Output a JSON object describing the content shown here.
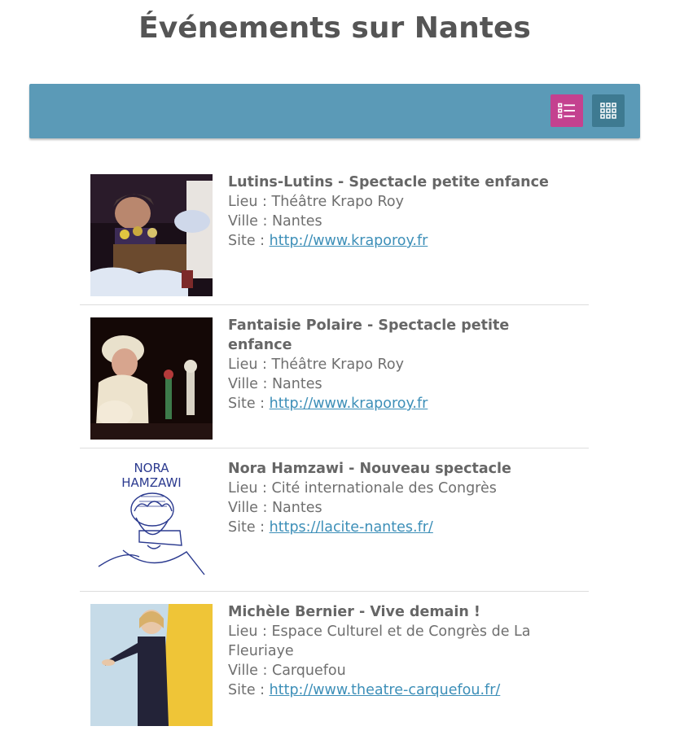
{
  "page": {
    "title": "Événements sur Nantes"
  },
  "toolbar": {
    "list_view_icon": "list-view-icon",
    "grid_view_icon": "grid-view-icon",
    "colors": {
      "bar": "#5b9ab7",
      "list_active": "#c4418f",
      "grid": "#3e7a91"
    }
  },
  "events": [
    {
      "title": "Lutins-Lutins - Spectacle petite enfance",
      "lieu_label": "Lieu : ",
      "lieu": "Théâtre Krapo Roy",
      "ville_label": "Ville : ",
      "ville": "Nantes",
      "site_label": "Site : ",
      "site": "http://www.kraporoy.fr",
      "image": "puppet-show-photo"
    },
    {
      "title": "Fantaisie Polaire - Spectacle petite enfance",
      "lieu_label": "Lieu : ",
      "lieu": "Théâtre Krapo Roy",
      "ville_label": "Ville : ",
      "ville": "Nantes",
      "site_label": "Site : ",
      "site": "http://www.kraporoy.fr",
      "image": "winter-costume-photo"
    },
    {
      "title": "Nora Hamzawi - Nouveau spectacle",
      "lieu_label": "Lieu : ",
      "lieu": "Cité internationale des Congrès",
      "ville_label": "Ville : ",
      "ville": "Nantes",
      "site_label": "Site : ",
      "site": "https://lacite-nantes.fr/",
      "image": "nora-hamzawi-drawing",
      "image_text": [
        "NORA",
        "HAMZAWI"
      ]
    },
    {
      "title": "Michèle Bernier - Vive demain !",
      "lieu_label": "Lieu : ",
      "lieu": "Espace Culturel et de Congrès de La Fleuriaye",
      "ville_label": "Ville : ",
      "ville": "Carquefou",
      "site_label": "Site : ",
      "site": "http://www.theatre-carquefou.fr/",
      "image": "michele-bernier-photo"
    }
  ]
}
